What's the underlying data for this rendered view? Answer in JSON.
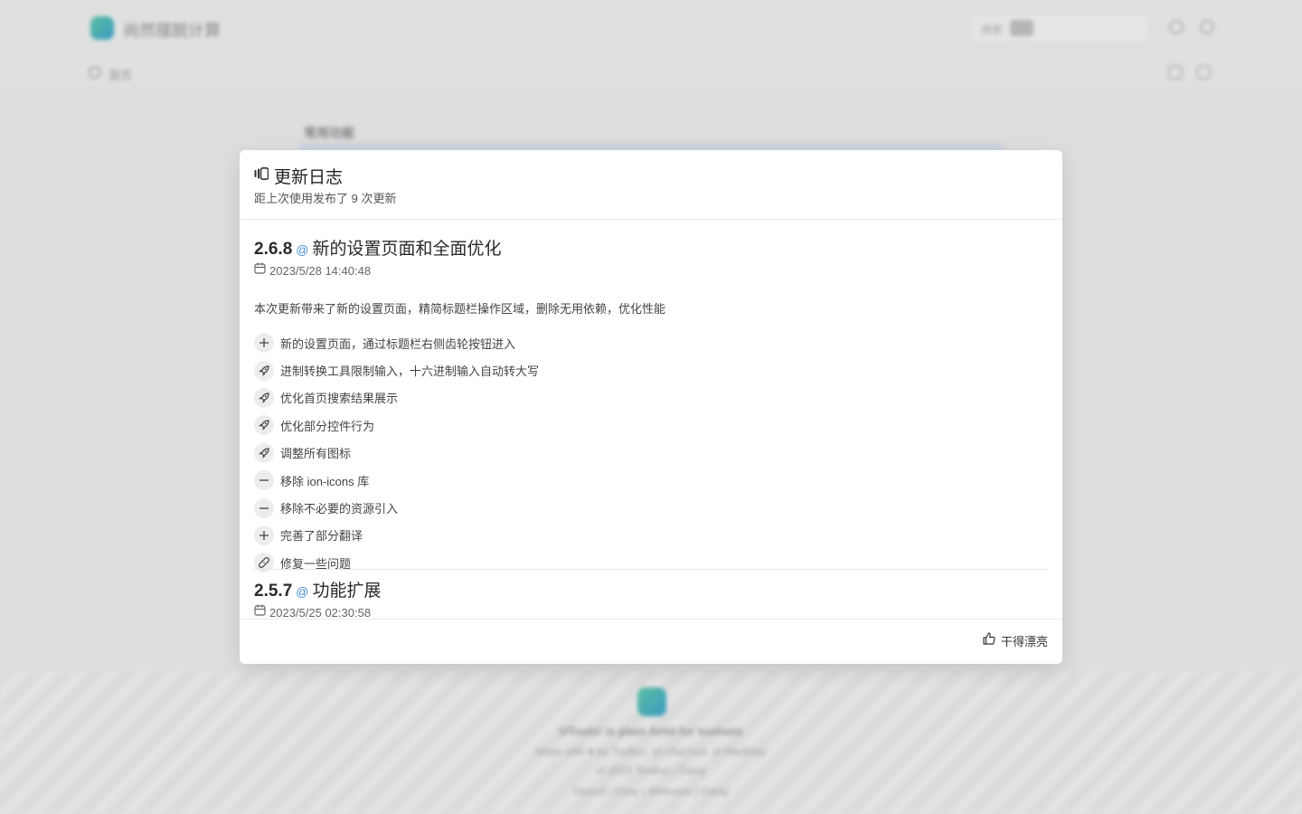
{
  "background": {
    "app_title": "尚然摆脱计算",
    "search": {
      "hint": "搜索",
      "kbd": ""
    },
    "home_label": "首页",
    "section_label": "常用功能",
    "footer": {
      "line1": "UTools! is plain Antd for toolsets",
      "line2": "Made with ♥ by Toolfun, of UlasTool, of MadWay",
      "line3": "of 2023 Toolfun | Daisy",
      "line4": "Stencil | Ebay | Webview | Datay"
    }
  },
  "modal": {
    "title": "更新日志",
    "subtitle": "距上次使用发布了 9 次更新",
    "releases": [
      {
        "version": "2.6.8",
        "at": "@",
        "name": "新的设置页面和全面优化",
        "date": "2023/5/28 14:40:48",
        "description": "本次更新带来了新的设置页面，精简标题栏操作区域，删除无用依赖，优化性能",
        "items": [
          {
            "icon": "plus-icon",
            "text": "新的设置页面，通过标题栏右侧齿轮按钮进入"
          },
          {
            "icon": "rocket-icon",
            "text": "进制转换工具限制输入，十六进制输入自动转大写"
          },
          {
            "icon": "rocket-icon",
            "text": "优化首页搜索结果展示"
          },
          {
            "icon": "rocket-icon",
            "text": "优化部分控件行为"
          },
          {
            "icon": "rocket-icon",
            "text": "调整所有图标"
          },
          {
            "icon": "minus-icon",
            "text": "移除 ion-icons 库"
          },
          {
            "icon": "minus-icon",
            "text": "移除不必要的资源引入"
          },
          {
            "icon": "plus-icon",
            "text": "完善了部分翻译"
          },
          {
            "icon": "bandage-icon",
            "text": "修复一些问题"
          }
        ]
      },
      {
        "version": "2.5.7",
        "at": "@",
        "name": "功能扩展",
        "date": "2023/5/25 02:30:58"
      }
    ],
    "footer_button": "干得漂亮"
  }
}
